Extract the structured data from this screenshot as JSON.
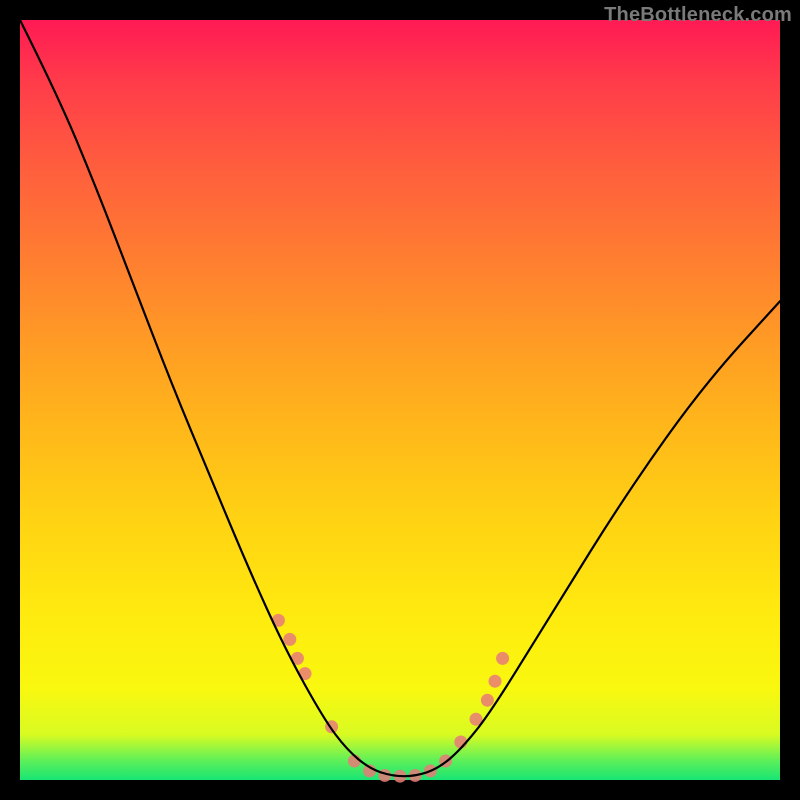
{
  "watermark": "TheBottleneck.com",
  "chart_data": {
    "type": "line",
    "title": "",
    "xlabel": "",
    "ylabel": "",
    "xlim": [
      0,
      100
    ],
    "ylim": [
      0,
      100
    ],
    "grid": false,
    "legend": false,
    "series": [
      {
        "name": "bottleneck-curve",
        "color": "#000000",
        "x": [
          0,
          5,
          10,
          15,
          20,
          25,
          30,
          35,
          40,
          43,
          46,
          49,
          52,
          55,
          58,
          62,
          70,
          80,
          90,
          100
        ],
        "y": [
          100,
          90,
          78,
          65,
          52,
          40,
          28,
          17,
          8,
          4,
          1.5,
          0.5,
          0.5,
          1.5,
          4,
          9,
          22,
          38,
          52,
          63
        ]
      }
    ],
    "scatter": {
      "name": "sample-points",
      "color": "#e87a78",
      "x": [
        34,
        35.5,
        36.5,
        37.5,
        41,
        44,
        46,
        48,
        50,
        52,
        54,
        56,
        58,
        60,
        61.5,
        62.5,
        63.5
      ],
      "y": [
        21,
        18.5,
        16,
        14,
        7,
        2.5,
        1.2,
        0.6,
        0.5,
        0.6,
        1.2,
        2.5,
        5,
        8,
        10.5,
        13,
        16
      ]
    },
    "gradient_stops": [
      {
        "pos": 0.0,
        "color": "#ff1a54"
      },
      {
        "pos": 0.5,
        "color": "#ffb81a"
      },
      {
        "pos": 0.88,
        "color": "#f9f80f"
      },
      {
        "pos": 1.0,
        "color": "#18e574"
      }
    ]
  }
}
